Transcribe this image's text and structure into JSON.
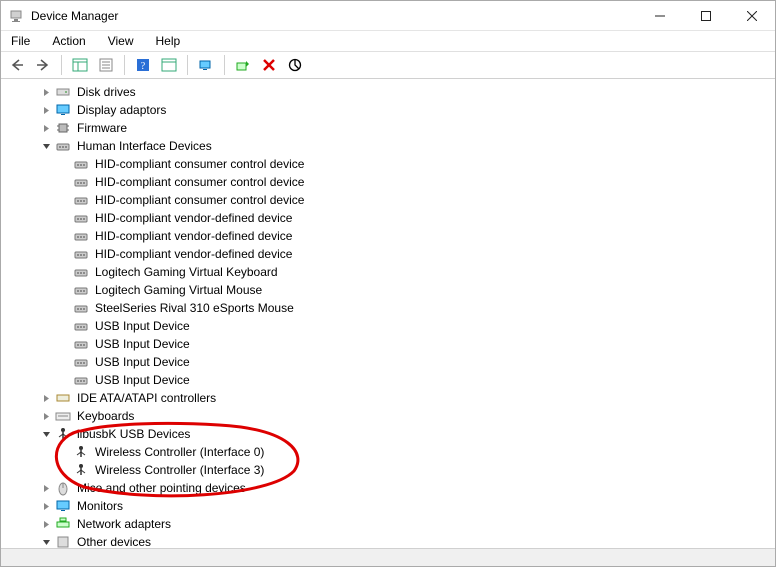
{
  "window": {
    "title": "Device Manager"
  },
  "menu": {
    "file": "File",
    "action": "Action",
    "view": "View",
    "help": "Help"
  },
  "tree": {
    "disk_drives": "Disk drives",
    "display_adaptors": "Display adaptors",
    "firmware": "Firmware",
    "hid": "Human Interface Devices",
    "hid_children": [
      "HID-compliant consumer control device",
      "HID-compliant consumer control device",
      "HID-compliant consumer control device",
      "HID-compliant vendor-defined device",
      "HID-compliant vendor-defined device",
      "HID-compliant vendor-defined device",
      "Logitech Gaming Virtual Keyboard",
      "Logitech Gaming Virtual Mouse",
      "SteelSeries Rival 310 eSports Mouse",
      "USB Input Device",
      "USB Input Device",
      "USB Input Device",
      "USB Input Device"
    ],
    "ide": "IDE ATA/ATAPI controllers",
    "keyboards": "Keyboards",
    "libusbk": "libusbK USB Devices",
    "libusbk_children": [
      "Wireless Controller (Interface 0)",
      "Wireless Controller (Interface 3)"
    ],
    "mice": "Mice and other pointing devices",
    "monitors": "Monitors",
    "network": "Network adapters",
    "other": "Other devices"
  }
}
